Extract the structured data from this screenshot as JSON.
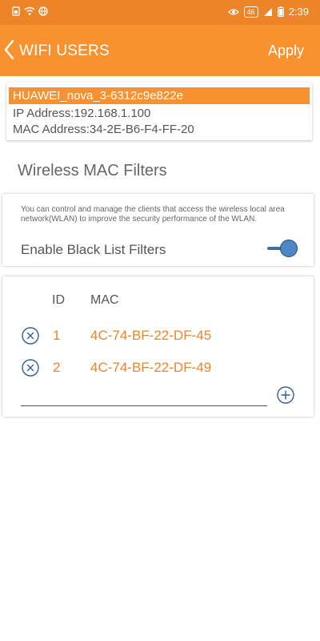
{
  "status_bar": {
    "network_badge": "46",
    "time": "2:39"
  },
  "header": {
    "title": "WIFI USERS",
    "apply_label": "Apply"
  },
  "device": {
    "name": "HUAWEI_nova_3-6312c9e822e",
    "ip_line": "IP Address:192.168.1.100",
    "mac_line": "MAC Address:34-2E-B6-F4-FF-20"
  },
  "section_title": "Wireless MAC Filters",
  "filter": {
    "description": "You can control and manage the clients that access the wireless local area network(WLAN) to improve the security performance of the WLAN.",
    "enable_label": "Enable Black List Filters",
    "enabled": true
  },
  "mac_list": {
    "columns": {
      "id": "ID",
      "mac": "MAC"
    },
    "rows": [
      {
        "id": "1",
        "mac": "4C-74-BF-22-DF-45"
      },
      {
        "id": "2",
        "mac": "4C-74-BF-22-DF-49"
      }
    ],
    "input_value": "",
    "input_placeholder": ""
  },
  "colors": {
    "accent": "#f7922f",
    "accent_text": "#ee8428",
    "toggle": "#4f86c6"
  }
}
